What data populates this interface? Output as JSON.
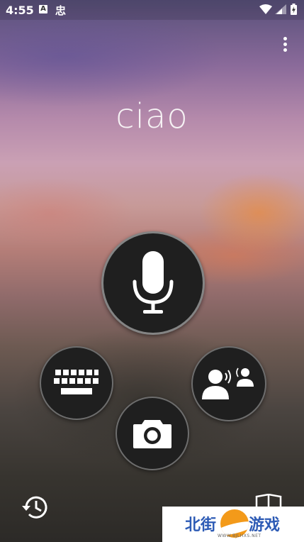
{
  "status_bar": {
    "time": "4:55",
    "notif_a": "A",
    "notif_glyph": "忠",
    "icons": [
      "wifi-icon",
      "signal-icon",
      "battery-icon"
    ]
  },
  "top_bar": {
    "menu_icon": "more-vert-icon"
  },
  "translation": {
    "text": "ciao"
  },
  "actions": {
    "microphone": "microphone-icon",
    "keyboard": "keyboard-icon",
    "conversation": "conversation-icon",
    "camera": "camera-icon",
    "history": "history-icon",
    "phrasebook": "book-icon"
  },
  "watermark": {
    "left_text": "北街",
    "right_text": "游戏",
    "small_text": "WWW.BJLHXS.NET"
  },
  "colors": {
    "button_bg": "#1f1f1f",
    "icon": "#ffffff",
    "watermark_text": "#2d5bb5",
    "watermark_logo": "#f39a1a"
  }
}
